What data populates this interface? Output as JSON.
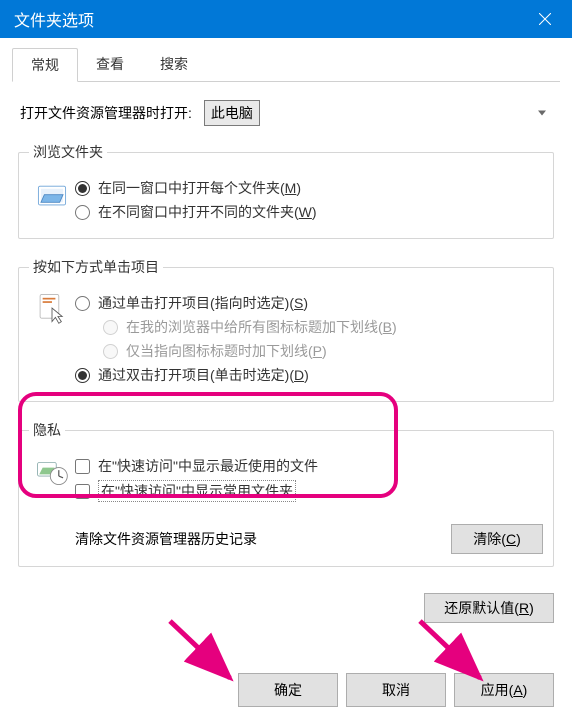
{
  "window": {
    "title": "文件夹选项"
  },
  "tabs": [
    {
      "label": "常规",
      "active": true
    },
    {
      "label": "查看",
      "active": false
    },
    {
      "label": "搜索",
      "active": false
    }
  ],
  "open_in": {
    "label": "打开文件资源管理器时打开:",
    "value": "此电脑"
  },
  "browse": {
    "legend": "浏览文件夹",
    "icon": "folder-browse-icon",
    "opt_same": "在同一窗口中打开每个文件夹(",
    "opt_same_key": "M",
    "opt_new": "在不同窗口中打开不同的文件夹(",
    "opt_new_key": "W",
    "close": ")"
  },
  "click": {
    "legend": "按如下方式单击项目",
    "icon": "cursor-click-icon",
    "opt_single": "通过单击打开项目(指向时选定)(",
    "opt_single_key": "S",
    "close": ")",
    "sub_all": "在我的浏览器中给所有图标标题加下划线(",
    "sub_all_key": "B",
    "sub_point": "仅当指向图标标题时加下划线(",
    "sub_point_key": "P",
    "opt_double": "通过双击打开项目(单击时选定)(",
    "opt_double_key": "D"
  },
  "privacy": {
    "legend": "隐私",
    "icon": "privacy-icon",
    "chk_recent": "在\"快速访问\"中显示最近使用的文件",
    "chk_frequent": "在\"快速访问\"中显示常用文件夹",
    "clear_label": "清除文件资源管理器历史记录",
    "clear_btn": "清除(",
    "clear_key": "C"
  },
  "restore": {
    "label": "还原默认值(",
    "key": "R",
    "close": ")"
  },
  "buttons": {
    "ok": "确定",
    "cancel": "取消",
    "apply": "应用(",
    "apply_key": "A",
    "close": ")"
  },
  "colors": {
    "accent": "#0178d7",
    "highlight": "#e5007e"
  }
}
